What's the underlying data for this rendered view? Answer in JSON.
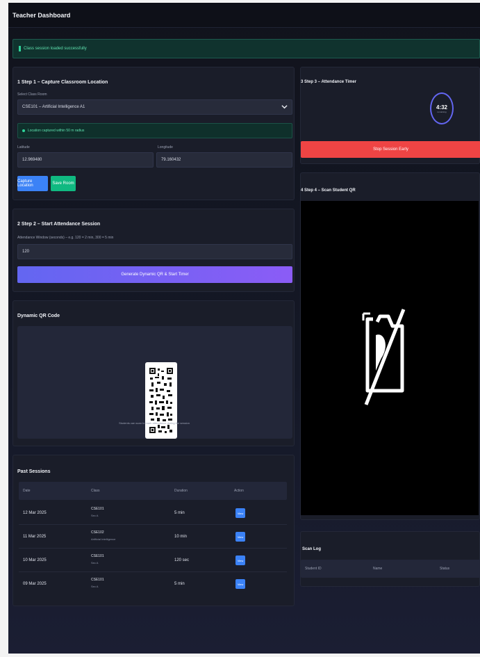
{
  "app": {
    "title": "Teacher Dashboard"
  },
  "notice": {
    "text": "Class session loaded successfully"
  },
  "step1": {
    "title": "1 Step 1 – Capture Classroom Location",
    "select_label": "Select Class Room",
    "select_value": "CSE101 – Artificial Intelligence A1",
    "location_status": "Location captured within 50 m radius",
    "lat_label": "Latitude",
    "lat_value": "12.969480",
    "lon_label": "Longitude",
    "lon_value": "79.160432",
    "btn_capture": "Capture Location",
    "btn_save": "Save Room"
  },
  "step2": {
    "title": "2 Step 2 – Start Attendance Session",
    "label": "Attendance Window (seconds) – e.g. 120 = 2 min, 300 = 5 min",
    "value": "120",
    "btn_start": "Generate Dynamic QR & Start Timer"
  },
  "qr": {
    "title": "Dynamic QR Code",
    "caption": "Students can scan to mark attendance during the session"
  },
  "sessions": {
    "title": "Past Sessions",
    "headers": [
      "Date",
      "Class",
      "Duration",
      "Action"
    ],
    "rows": [
      {
        "date": "12 Mar 2025",
        "class": "CSE101",
        "class_sub": "Sec A",
        "duration": "5 min",
        "action": "View"
      },
      {
        "date": "11 Mar 2025",
        "class": "CSE102",
        "class_sub": "Artificial Intelligence",
        "duration": "10 min",
        "action": "View"
      },
      {
        "date": "10 Mar 2025",
        "class": "CSE101",
        "class_sub": "Sec A",
        "duration": "120 sec",
        "action": "View"
      },
      {
        "date": "09 Mar 2025",
        "class": "CSE101",
        "class_sub": "Sec A",
        "duration": "5 min",
        "action": "View"
      }
    ]
  },
  "step3": {
    "title": "3 Step 3 – Attendance Timer",
    "time": "4:32",
    "time_sub": "remaining",
    "btn_stop": "Stop Session Early"
  },
  "step4": {
    "title": "4 Step 4 – Scan Student QR"
  },
  "scan_log": {
    "title": "Scan Log",
    "headers": [
      "Student ID",
      "Name",
      "Status"
    ]
  },
  "colors": {
    "accent_blue": "#3b82f6",
    "accent_green": "#10b981",
    "accent_purple": "#7c5cf0",
    "danger_red": "#ef4444",
    "ring_indigo": "#6366f1"
  },
  "icons": {
    "camera_off": "camera-off-icon",
    "dropdown": "chevron-down-icon"
  }
}
